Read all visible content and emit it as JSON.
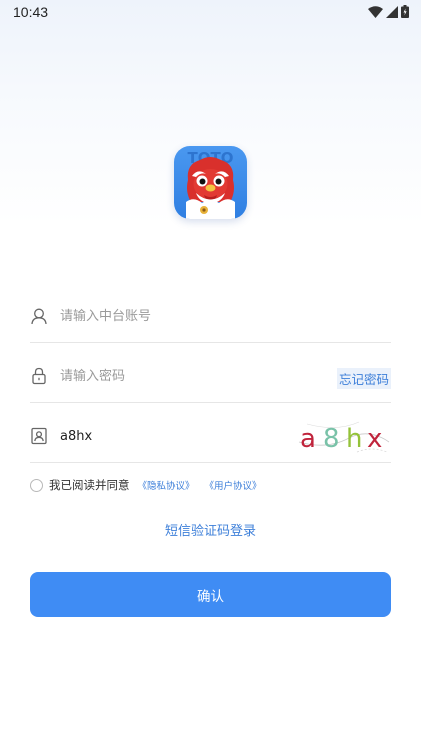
{
  "status_bar": {
    "time": "10:43",
    "icons": [
      "wifi-icon",
      "cellular-signal-icon",
      "battery-icon"
    ]
  },
  "logo": {
    "icon": "lion-mascot-logo",
    "banner_text": "TOTO",
    "colors": {
      "background": "#3a8ae8",
      "mascot_red": "#d9302c",
      "mascot_white": "#ffffff"
    }
  },
  "form": {
    "account": {
      "icon": "user-icon",
      "value": "",
      "placeholder": "请输入中台账号"
    },
    "password": {
      "icon": "lock-icon",
      "value": "",
      "placeholder": "请输入密码",
      "forgot_label": "忘记密码"
    },
    "captcha": {
      "icon": "id-card-icon",
      "value": "a8hx",
      "placeholder": "",
      "image_chars": [
        "a",
        "8",
        "h",
        "x"
      ],
      "image_colors": [
        "#c0243c",
        "#79c2a8",
        "#94c23a",
        "#c0243c"
      ]
    }
  },
  "agreement": {
    "checked": false,
    "text": "我已阅读并同意",
    "privacy_link": "《隐私协议》",
    "user_link": "《用户协议》"
  },
  "sms_login_label": "短信验证码登录",
  "confirm_label": "确认",
  "colors": {
    "accent": "#3f8cf4",
    "link": "#3d7fd9",
    "divider": "#e6e6e6",
    "placeholder": "#9a9a9a"
  }
}
